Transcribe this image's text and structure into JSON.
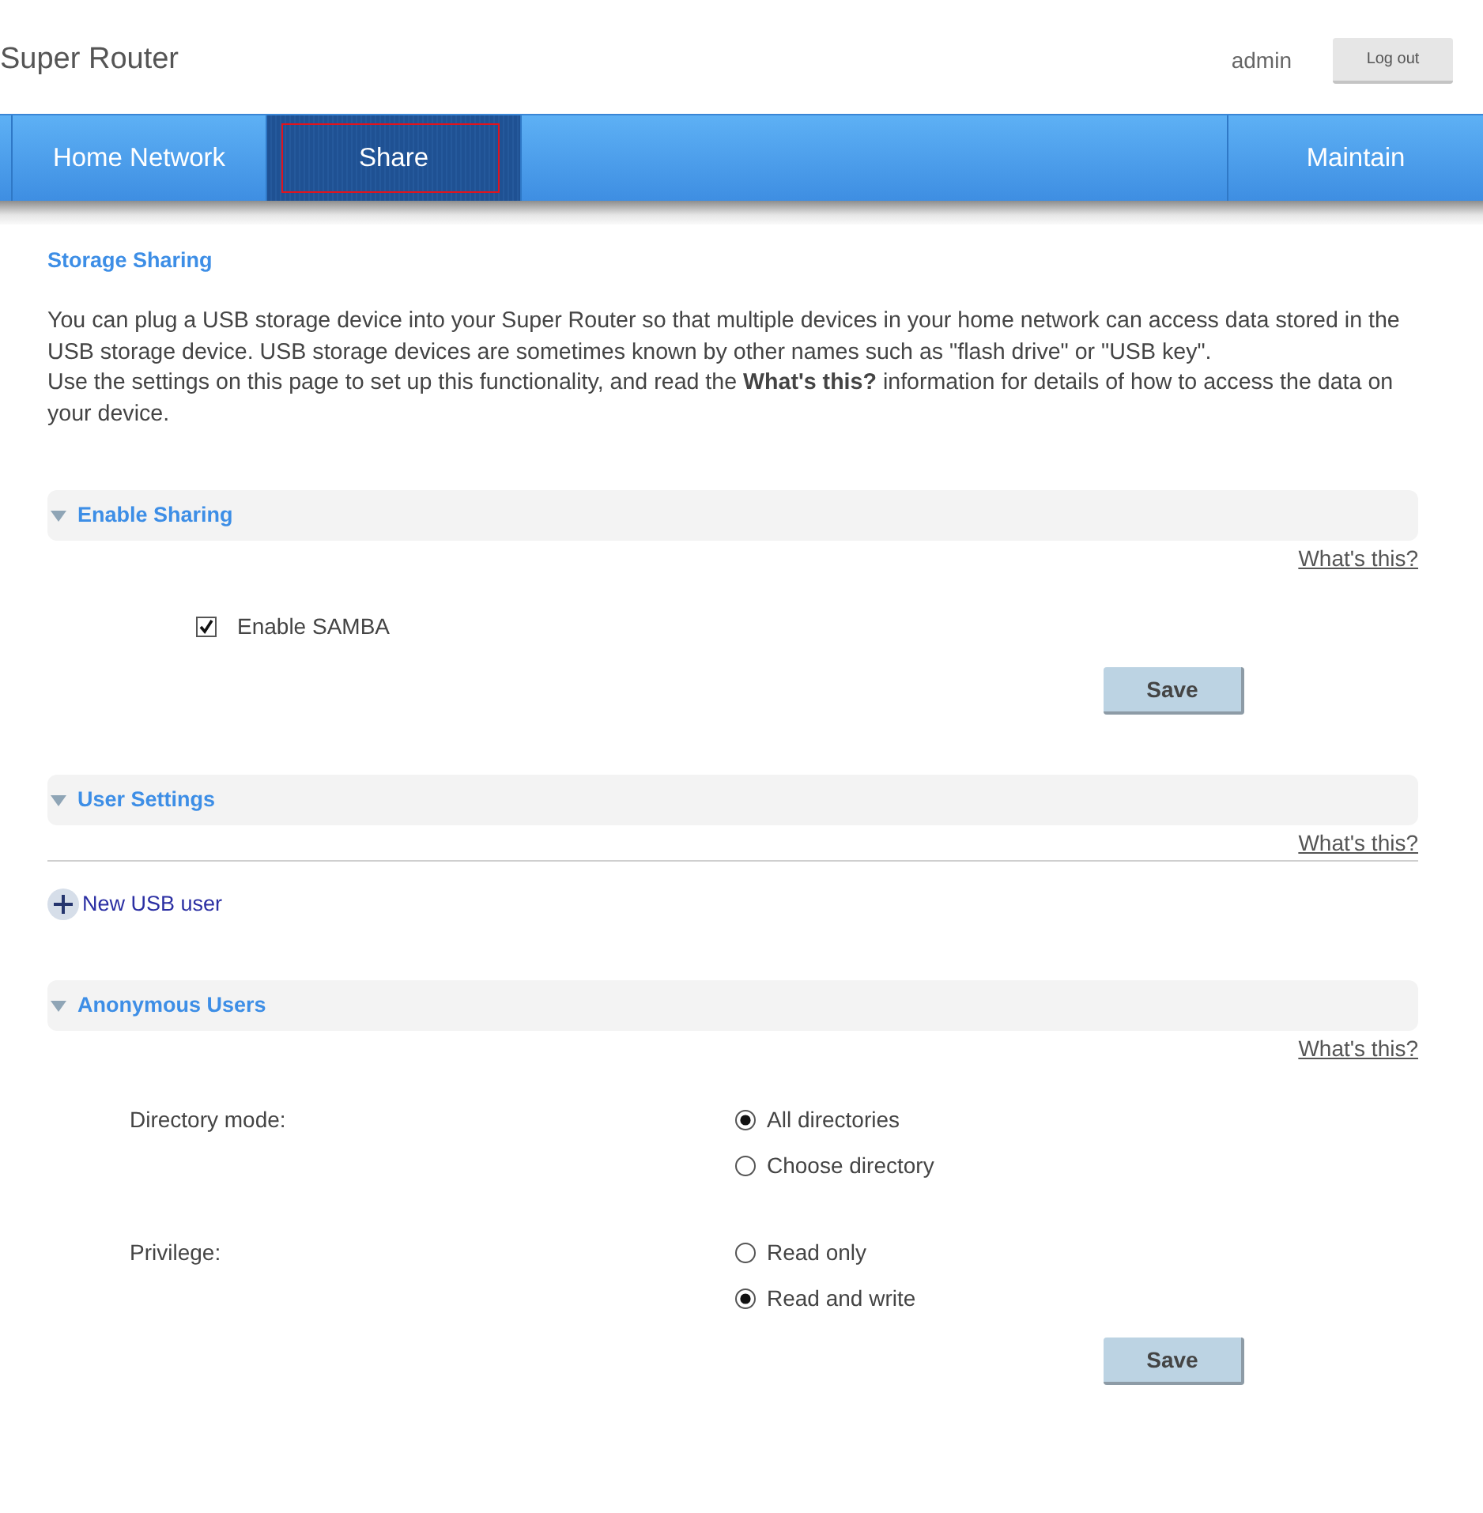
{
  "header": {
    "brand": "Super Router",
    "user": "admin",
    "logout_button": "Log out"
  },
  "nav": {
    "tabs": [
      {
        "label": "Home Network",
        "selected": false
      },
      {
        "label": "Share",
        "selected": true
      }
    ],
    "right_tabs": [
      {
        "label": "Maintain",
        "selected": false
      }
    ]
  },
  "page": {
    "title": "Storage Sharing",
    "intro": [
      "You can plug a USB storage device into your Super Router so that multiple devices in your home network can access data stored in the USB storage device. USB storage devices are sometimes known by other names such as \"flash drive\" or \"USB key\".",
      "Use the settings on this page to set up this functionality, and read the **What's this?** information for details of how to access the data on your device."
    ]
  },
  "sections": [
    {
      "kind": "checkbox",
      "title": "Enable Sharing",
      "expanded": true,
      "help_link": "What's this?",
      "options": [
        {
          "label": "Enable SAMBA",
          "checked": true
        }
      ],
      "save_button": "Save"
    },
    {
      "kind": "users",
      "title": "User Settings",
      "expanded": true,
      "help_link": "What's this?",
      "add_link": "New USB user"
    },
    {
      "kind": "radios",
      "title": "Anonymous Users",
      "expanded": true,
      "help_link": "What's this?",
      "groups": [
        {
          "label": "Directory mode:",
          "options": [
            {
              "label": "All directories",
              "selected": true
            },
            {
              "label": "Choose directory",
              "selected": false
            }
          ]
        },
        {
          "label": "Privilege:",
          "options": [
            {
              "label": "Read only",
              "selected": false
            },
            {
              "label": "Read and write",
              "selected": true
            }
          ]
        }
      ],
      "save_button": "Save"
    }
  ]
}
